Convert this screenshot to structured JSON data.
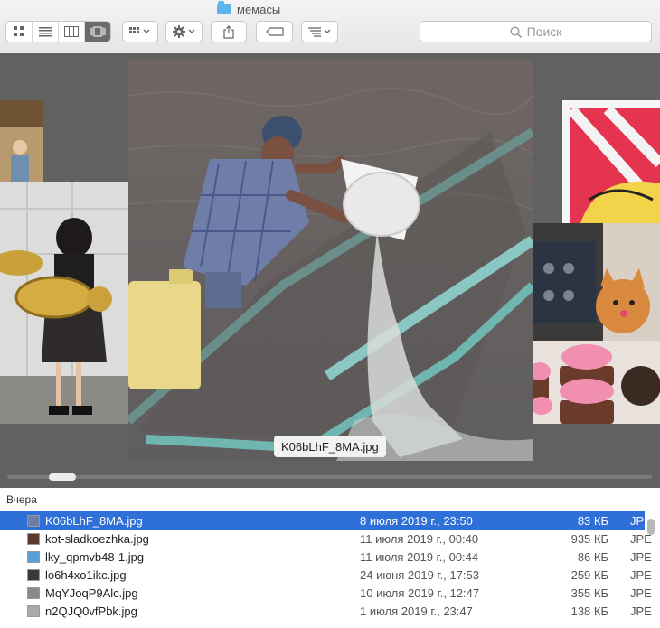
{
  "window": {
    "title": "мемасы",
    "folder_icon": "folder-icon"
  },
  "toolbar": {
    "view_modes": [
      "icon-view-icon",
      "list-view-icon",
      "column-view-icon",
      "coverflow-view-icon"
    ],
    "active_view": "coverflow",
    "arrange_icon": "grid-arrange-icon",
    "action_icon": "gear-icon",
    "share_icon": "share-icon",
    "tag_icon": "tag-icon",
    "sort_icon": "sort-icon",
    "search_placeholder": "Поиск"
  },
  "coverflow": {
    "caption": "K06bLhF_8MA.jpg",
    "main_image": "man pouring water from bucket into flooded boat",
    "side_images": [
      "tuba girl",
      "pink cartoon",
      "orange cat",
      "pink cupcakes",
      "kid in room"
    ]
  },
  "file_list": {
    "group_label": "Вчера",
    "rows": [
      {
        "name": "K06bLhF_8MA.jpg",
        "date": "8 июля 2019 г., 23:50",
        "size": "83 КБ",
        "kind": "JPE",
        "selected": true
      },
      {
        "name": "kot-sladkoezhka.jpg",
        "date": "11 июля 2019 г., 00:40",
        "size": "935 КБ",
        "kind": "JPE",
        "selected": false
      },
      {
        "name": "lky_qpmvb48-1.jpg",
        "date": "11 июля 2019 г., 00:44",
        "size": "86 КБ",
        "kind": "JPE",
        "selected": false
      },
      {
        "name": "lo6h4xo1ikc.jpg",
        "date": "24 июня 2019 г., 17:53",
        "size": "259 КБ",
        "kind": "JPE",
        "selected": false
      },
      {
        "name": "MqYJoqP9Alc.jpg",
        "date": "10 июля 2019 г., 12:47",
        "size": "355 КБ",
        "kind": "JPE",
        "selected": false
      },
      {
        "name": "n2QJQ0vfPbk.jpg",
        "date": "1 июля 2019 г., 23:47",
        "size": "138 КБ",
        "kind": "JPE",
        "selected": false
      }
    ]
  },
  "colors": {
    "selection": "#2f6fd8",
    "coverflow_bg": "#616161",
    "folder": "#5fb4f0"
  }
}
